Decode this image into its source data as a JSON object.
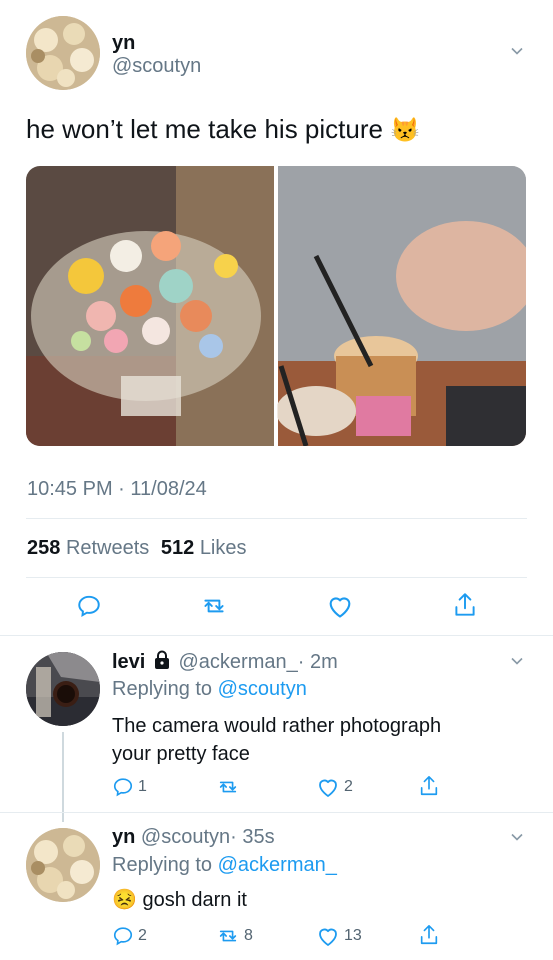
{
  "main_tweet": {
    "name": "yn",
    "handle": "@scoutyn",
    "text": "he won’t let me take his picture",
    "emoji": "😾",
    "timestamp": "10:45 PM · 11/08/24",
    "retweets": "258",
    "retweets_label": "Retweets",
    "likes": "512",
    "likes_label": "Likes"
  },
  "replies": [
    {
      "name": "levi",
      "handle": "@ackerman_",
      "time": "· 2m",
      "replying_prefix": "Replying to",
      "replying_handle": "@scoutyn",
      "text_line1": "The camera would rather photograph",
      "text_line2": "your pretty face",
      "reply_count": "1",
      "retweet_count": "",
      "like_count": "2"
    },
    {
      "name": "yn",
      "handle": "@scoutyn",
      "time": "· 35s",
      "replying_prefix": "Replying to",
      "replying_handle": "@ackerman_",
      "emoji": "😣",
      "text": "gosh darn it",
      "reply_count": "2",
      "retweet_count": "8",
      "like_count": "13"
    }
  ],
  "colors": {
    "accent": "#1d9bf0",
    "muted": "#657786",
    "divider": "#e6ecf0"
  }
}
